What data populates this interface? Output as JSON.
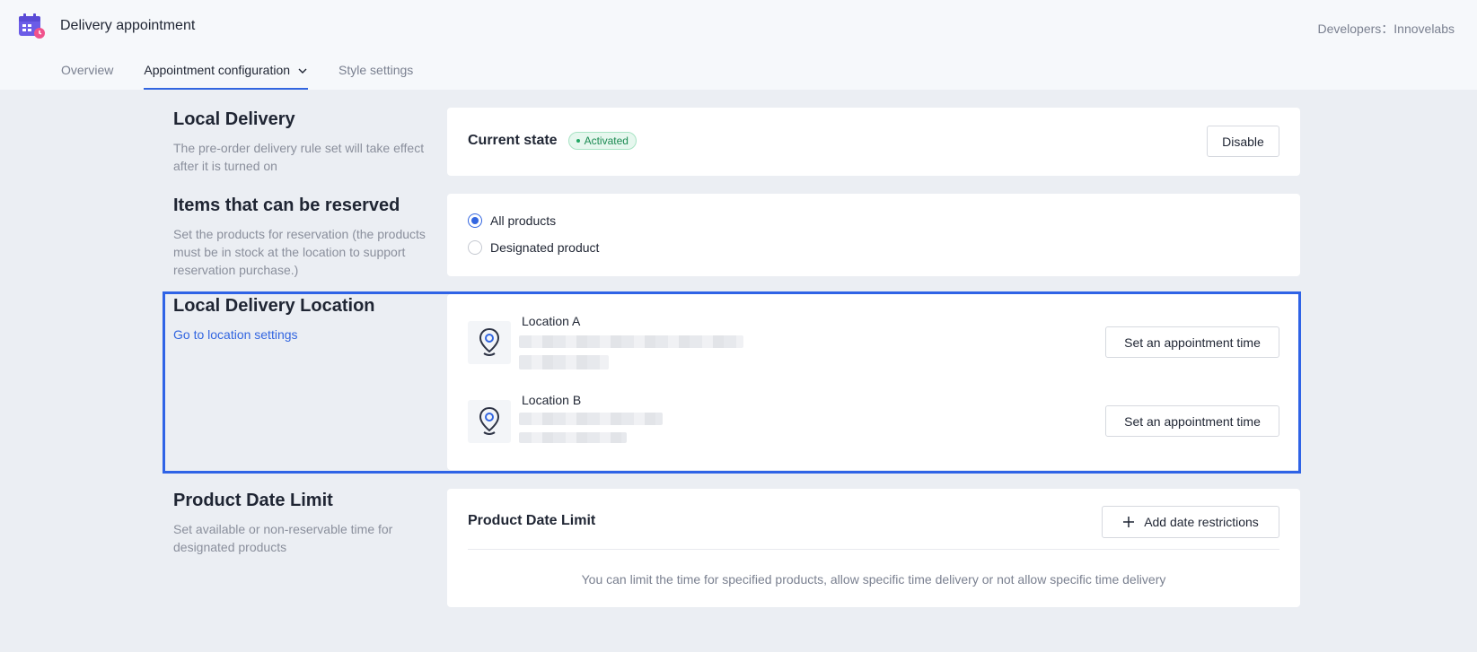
{
  "header": {
    "app_title": "Delivery appointment",
    "developer_label": "Developers：Innovelabs",
    "app_icon": "calendar-clock-icon"
  },
  "tabs": [
    {
      "label": "Overview",
      "active": false
    },
    {
      "label": "Appointment configuration",
      "active": true,
      "has_dropdown": true
    },
    {
      "label": "Style settings",
      "active": false
    }
  ],
  "local_delivery": {
    "title": "Local Delivery",
    "description": "The pre-order delivery rule set will take effect after it is turned on",
    "state_label": "Current state",
    "state_badge": "Activated",
    "disable_button": "Disable"
  },
  "reservable_items": {
    "title": "Items that can be reserved",
    "description": "Set the products for reservation (the products must be in stock at the location to support reservation purchase.)",
    "options": [
      {
        "label": "All products",
        "selected": true
      },
      {
        "label": "Designated product",
        "selected": false
      }
    ]
  },
  "delivery_location": {
    "title": "Local Delivery Location",
    "settings_link": "Go to location settings",
    "locations": [
      {
        "name": "Location A",
        "button": "Set an appointment time"
      },
      {
        "name": "Location B",
        "button": "Set an appointment time"
      }
    ]
  },
  "date_limit": {
    "title": "Product Date Limit",
    "description": "Set available or non-reservable time for designated products",
    "card_title": "Product Date Limit",
    "add_button": "Add date restrictions",
    "hint": "You can limit the time for specified products, allow specific time delivery or not allow specific time delivery"
  },
  "colors": {
    "accent": "#3366e0",
    "badge_green": "#21a663",
    "background": "#ebeef3"
  }
}
